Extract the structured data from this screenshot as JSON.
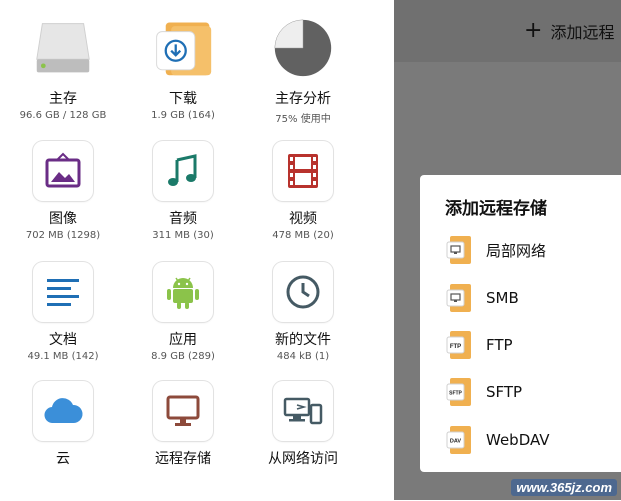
{
  "header": {
    "add_remote": "添加远程"
  },
  "tiles": [
    {
      "label": "主存",
      "sub": "96.6 GB / 128 GB"
    },
    {
      "label": "下载",
      "sub": "1.9 GB (164)"
    },
    {
      "label": "主存分析",
      "sub": "75% 使用中",
      "used_fraction": 0.75
    },
    {
      "label": "图像",
      "sub": "702 MB (1298)"
    },
    {
      "label": "音频",
      "sub": "311 MB (30)"
    },
    {
      "label": "视频",
      "sub": "478 MB (20)"
    },
    {
      "label": "文档",
      "sub": "49.1 MB (142)"
    },
    {
      "label": "应用",
      "sub": "8.9 GB (289)"
    },
    {
      "label": "新的文件",
      "sub": "484 kB (1)"
    },
    {
      "label": "云",
      "sub": ""
    },
    {
      "label": "远程存储",
      "sub": ""
    },
    {
      "label": "从网络访问",
      "sub": ""
    }
  ],
  "dialog": {
    "title": "添加远程存储",
    "items": [
      {
        "label": "局部网络",
        "badge": ""
      },
      {
        "label": "SMB",
        "badge": ""
      },
      {
        "label": "FTP",
        "badge": "FTP"
      },
      {
        "label": "SFTP",
        "badge": "SFTP"
      },
      {
        "label": "WebDAV",
        "badge": "DAV"
      }
    ]
  },
  "watermark": "www.365jz.com",
  "colors": {
    "folder_orange": "#f0b050",
    "purple": "#6a2d86",
    "teal": "#1b7a69",
    "film_red": "#b8322d",
    "doc_blue": "#1f6fb5",
    "android_green": "#8bc34a",
    "clock_gray": "#455a64",
    "cloud_blue": "#3b8fd9",
    "remote_brown": "#8d4a3b"
  }
}
